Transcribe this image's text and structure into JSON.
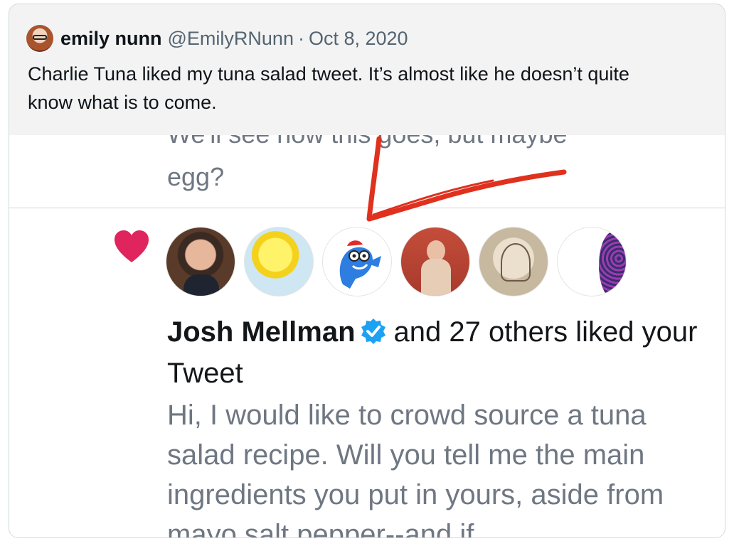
{
  "quote": {
    "author_name": "emily nunn",
    "handle": "@EmilyRNunn",
    "separator": "·",
    "date": "Oct 8, 2020",
    "text": "Charlie Tuna liked my tuna salad tweet. It’s almost like he doesn’t quite know what is to come."
  },
  "embedded": {
    "previous_tweet_cut": "We'll see how this goes, but maybe",
    "previous_tweet_end": "egg?",
    "notification": {
      "liker_name": "Josh Mellman",
      "suffix": "and 27 others liked your Tweet",
      "liked_tweet_text": "Hi, I would like to crowd source a tuna salad recipe. Will you tell me the main ingredients you put in yours, aside from mayo salt pepper--and if"
    },
    "heart_color": "#e0245e",
    "verified_color": "#1da1f2",
    "arrow_color": "#e0301e"
  }
}
